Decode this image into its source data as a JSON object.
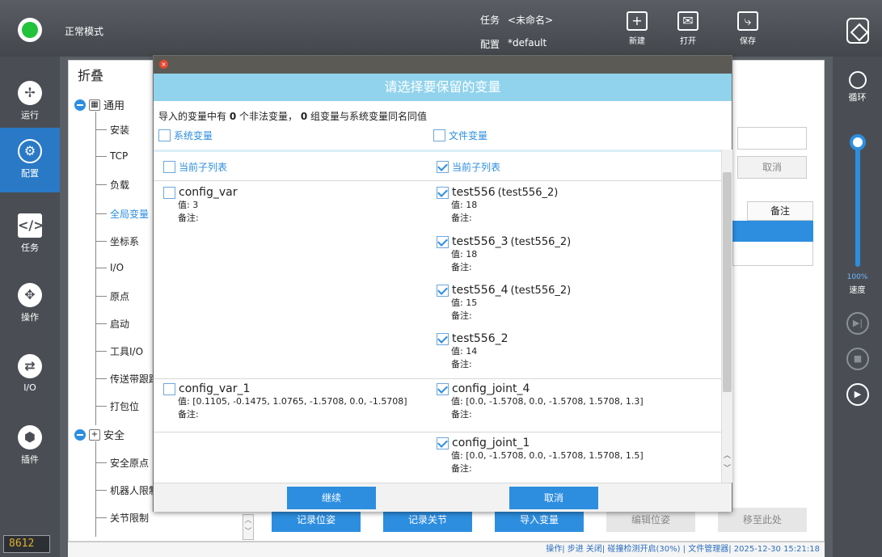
{
  "topbar": {
    "mode": "正常模式",
    "task_label": "任务",
    "task_value": "<未命名>",
    "config_label": "配置",
    "config_value": "*default",
    "new_label": "新建",
    "open_label": "打开",
    "save_label": "保存"
  },
  "leftrail": {
    "items": [
      {
        "label": "运行",
        "icon": "run-icon"
      },
      {
        "label": "配置",
        "icon": "config-icon"
      },
      {
        "label": "任务",
        "icon": "task-icon"
      },
      {
        "label": "操作",
        "icon": "move-icon"
      },
      {
        "label": "I/O",
        "icon": "io-icon"
      },
      {
        "label": "插件",
        "icon": "plugin-icon"
      }
    ],
    "active": "配置",
    "counter": "8612"
  },
  "rightrail": {
    "loop_label": "循环",
    "speed_percent": "100%",
    "speed_label": "速度",
    "speed_value": 1.0
  },
  "panel": {
    "fold_title": "折叠",
    "group_general": "通用",
    "items_general": [
      "安装",
      "TCP",
      "负载",
      "全局变量",
      "坐标系",
      "I/O",
      "原点",
      "启动",
      "工具I/O",
      "传送带跟踪",
      "打包位"
    ],
    "selected_item": "全局变量",
    "group_safety": "安全",
    "items_safety": [
      "安全原点",
      "机器人限制",
      "关节限制"
    ],
    "cancel": "取消",
    "note_header": "备注",
    "actions": [
      "记录位姿",
      "记录关节",
      "导入变量",
      "编辑位姿",
      "移至此处"
    ]
  },
  "statusbar": {
    "text": "操作| 步进 关闭| 碰撞检测开启(30%) | 文件管理器| 2025-12-30 15:21:18"
  },
  "dialog": {
    "title": "请选择要保留的变量",
    "info_prefix": "导入的变量中有 ",
    "illegal_count": "0",
    "info_mid": " 个非法变量， ",
    "conflict_count": "0",
    "info_suffix": " 组变量与系统变量同名同值",
    "system_vars": "系统变量",
    "file_vars": "文件变量",
    "left_sub": "当前子列表",
    "right_sub": "当前子列表",
    "left_vars": [
      {
        "name": "config_var",
        "value": "值: 3",
        "note": "备注:",
        "checked": false
      },
      {
        "name": "config_var_1",
        "value": "值: [0.1105, -0.1475, 1.0765, -1.5708, 0.0, -1.5708]",
        "note": "备注:",
        "checked": false
      }
    ],
    "right_vars": [
      {
        "name": "test556",
        "source": "(test556_2)",
        "value": "值: 18",
        "note": "备注:",
        "checked": true
      },
      {
        "name": "test556_3",
        "source": "(test556_2)",
        "value": "值: 18",
        "note": "备注:",
        "checked": true
      },
      {
        "name": "test556_4",
        "source": "(test556_2)",
        "value": "值: 15",
        "note": "备注:",
        "checked": true
      },
      {
        "name": "test556_2",
        "source": "",
        "value": "值: 14",
        "note": "备注:",
        "checked": true
      },
      {
        "name": "config_joint_4",
        "source": "",
        "value": "值: [0.0, -1.5708, 0.0, -1.5708, 1.5708, 1.3]",
        "note": "备注:",
        "checked": true
      },
      {
        "name": "config_joint_1",
        "source": "",
        "value": "值: [0.0, -1.5708, 0.0, -1.5708, 1.5708, 1.5]",
        "note": "备注:",
        "checked": true
      }
    ],
    "continue": "继续",
    "cancel": "取消"
  }
}
